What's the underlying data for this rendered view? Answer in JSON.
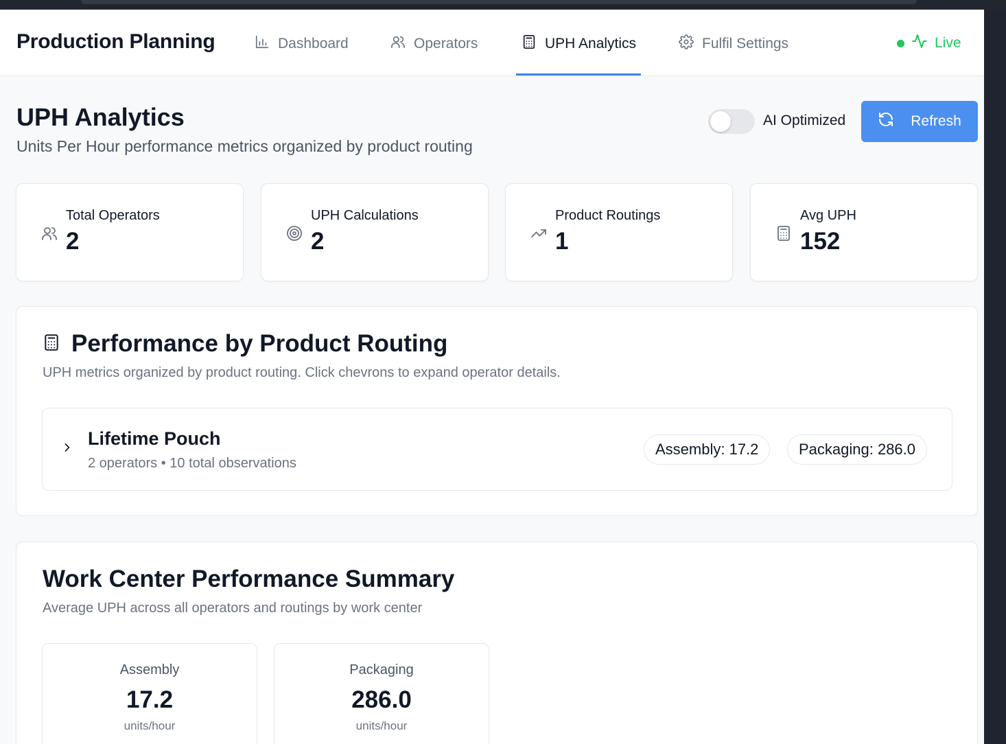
{
  "nav": {
    "brand": "Production Planning",
    "items": [
      {
        "label": "Dashboard",
        "icon": "bar-chart-icon"
      },
      {
        "label": "Operators",
        "icon": "users-icon"
      },
      {
        "label": "UPH Analytics",
        "icon": "calculator-icon",
        "active": true
      },
      {
        "label": "Fulfil Settings",
        "icon": "gear-icon"
      }
    ],
    "live_label": "Live"
  },
  "header": {
    "title": "UPH Analytics",
    "subtitle": "Units Per Hour performance metrics organized by product routing",
    "toggle_label": "AI Optimized",
    "toggle_on": false,
    "refresh_label": "Refresh"
  },
  "stats": [
    {
      "label": "Total Operators",
      "value": "2",
      "icon": "users-icon"
    },
    {
      "label": "UPH Calculations",
      "value": "2",
      "icon": "target-icon"
    },
    {
      "label": "Product Routings",
      "value": "1",
      "icon": "trending-up-icon"
    },
    {
      "label": "Avg UPH",
      "value": "152",
      "icon": "calculator-icon"
    }
  ],
  "routing_panel": {
    "title": "Performance by Product Routing",
    "description": "UPH metrics organized by product routing. Click chevrons to expand operator details.",
    "routings": [
      {
        "name": "Lifetime Pouch",
        "meta": "2 operators • 10 total observations",
        "badges": [
          "Assembly: 17.2",
          "Packaging: 286.0"
        ]
      }
    ]
  },
  "summary_panel": {
    "title": "Work Center Performance Summary",
    "description": "Average UPH across all operators and routings by work center",
    "centers": [
      {
        "name": "Assembly",
        "value": "17.2",
        "unit": "units/hour"
      },
      {
        "name": "Packaging",
        "value": "286.0",
        "unit": "units/hour"
      }
    ]
  },
  "colors": {
    "accent": "#4b8ff0",
    "live": "#22c55e",
    "underline": "#3b82f6"
  }
}
